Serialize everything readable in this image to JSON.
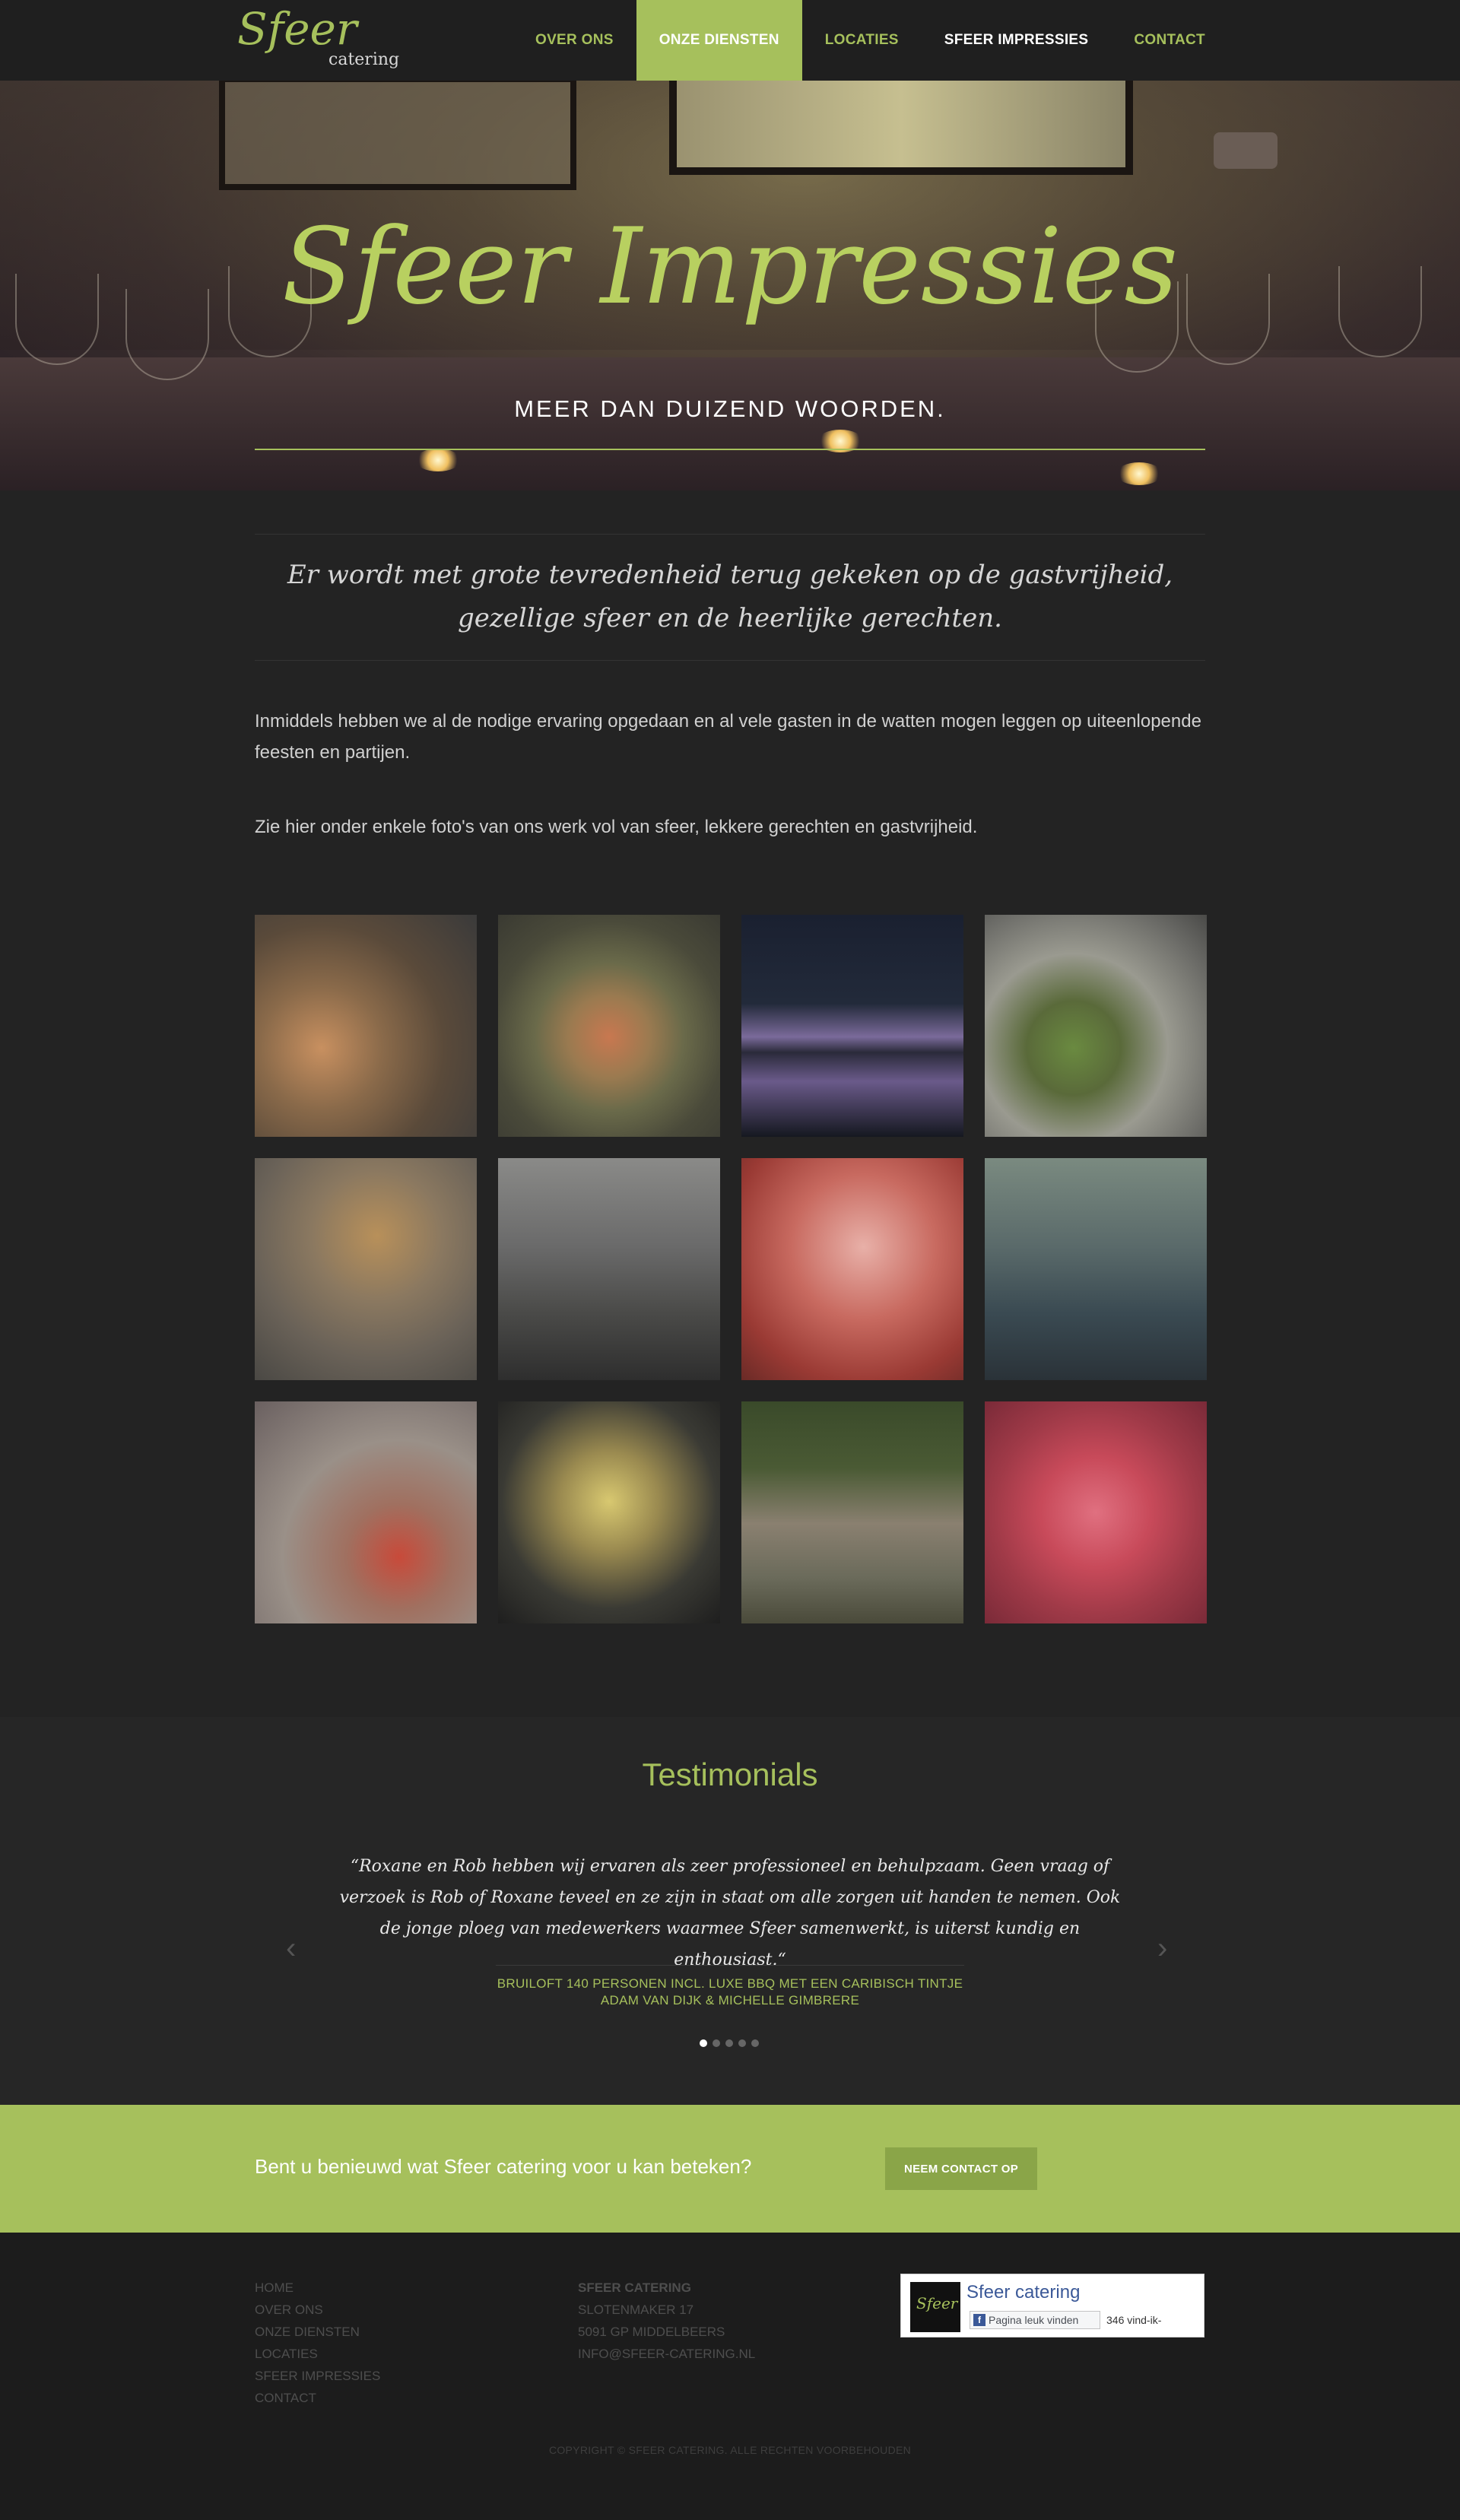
{
  "nav": {
    "logo_script": "Sfeer",
    "logo_sub": "catering",
    "items": [
      {
        "label": "OVER ONS"
      },
      {
        "label": "ONZE DIENSTEN"
      },
      {
        "label": "LOCATIES"
      },
      {
        "label": "SFEER IMPRESSIES"
      },
      {
        "label": "CONTACT"
      }
    ],
    "active_item": "ONZE DIENSTEN"
  },
  "hero": {
    "title": "Sfeer Impressies",
    "subtitle": "MEER DAN DUIZEND WOORDEN."
  },
  "intro": {
    "quote": "Er wordt met grote tevredenheid terug gekeken op de gastvrijheid, gezellige sfeer en de heerlijke gerechten.",
    "paragraph1": "Inmiddels hebben we al de nodige ervaring opgedaan en al vele gasten in de watten mogen leggen op uiteenlopende feesten en partijen.",
    "paragraph2": "Zie hier onder enkele foto's van ons werk vol van sfeer, lekkere gerechten en gastvrijheid."
  },
  "gallery": {
    "photos": [
      {
        "subject": "buffet table with cheese and meats"
      },
      {
        "subject": "salmon tartare with cucumber"
      },
      {
        "subject": "illuminated tents reflected in water at night"
      },
      {
        "subject": "plates of salad being garnished"
      },
      {
        "subject": "champagne glasses and cutlery"
      },
      {
        "subject": "bar with standing tables"
      },
      {
        "subject": "rosé bottle in ice bucket"
      },
      {
        "subject": "tent interior with cocktail tables"
      },
      {
        "subject": "canapés and tomato skewer"
      },
      {
        "subject": "yellow straws in cocktail"
      },
      {
        "subject": "wooden garden table with flowers"
      },
      {
        "subject": "red cocktails with lime"
      }
    ]
  },
  "testimonials": {
    "title": "Testimonials",
    "quote": "“Roxane en Rob hebben wij ervaren als zeer professioneel en behulpzaam. Geen vraag of verzoek is Rob of Roxane teveel en ze zijn in staat om alle zorgen uit handen te nemen. Ook de jonge ploeg van medewerkers waarmee Sfeer samenwerkt, is uiterst kundig en enthousiast.“",
    "event": "BRUILOFT 140 PERSONEN INCL. LUXE BBQ MET EEN CARIBISCH TINTJE",
    "author": "ADAM VAN DIJK & MICHELLE GIMBRERE",
    "prev_icon": "chevron-left-icon",
    "next_icon": "chevron-right-icon",
    "slide_count": 5,
    "active_slide": 1
  },
  "cta": {
    "text": "Bent u benieuwd wat Sfeer catering voor u kan beteken?",
    "button": "NEEM CONTACT OP"
  },
  "footer": {
    "links": [
      "HOME",
      "OVER ONS",
      "ONZE DIENSTEN",
      "LOCATIES",
      "SFEER IMPRESSIES",
      "CONTACT"
    ],
    "company": {
      "name": "SFEER CATERING",
      "street": "SLOTENMAKER 17",
      "city": "5091 GP MIDDELBEERS",
      "email": "INFO@SFEER-CATERING.NL"
    },
    "facebook": {
      "page_name": "Sfeer catering",
      "thumb_text": "Sfeer",
      "like_label": "Pagina leuk vinden",
      "like_count": "346 vind-ik-"
    },
    "copyright": "COPYRIGHT © SFEER CATERING. ALLE RECHTEN VOORBEHOUDEN"
  },
  "colors": {
    "accent": "#a6c05c",
    "background": "#232323",
    "footer": "#1c1c1c"
  }
}
